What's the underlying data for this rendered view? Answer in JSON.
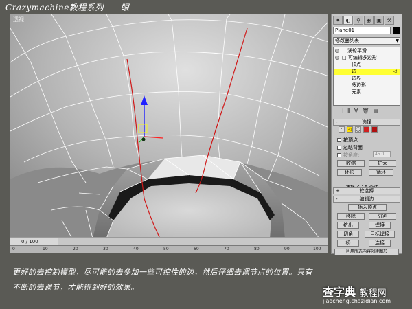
{
  "header": {
    "title": "Crazymachine教程系列——眼"
  },
  "viewport": {
    "label": "透视",
    "timeline": {
      "slider_text": "0 / 100"
    },
    "ruler_ticks": [
      "0",
      "10",
      "20",
      "30",
      "40",
      "50",
      "60",
      "70",
      "80",
      "90",
      "100"
    ]
  },
  "panel": {
    "tabs": [
      "create-tab",
      "modify-tab",
      "hierarchy-tab",
      "motion-tab",
      "display-tab",
      "utilities-tab"
    ],
    "object_name": "Plane01",
    "object_color": "#000000",
    "modifier_list": "修改器列表",
    "stack": [
      {
        "label": "涡轮平滑",
        "tag": ""
      },
      {
        "label": "□ 可编辑多边形",
        "tag": ""
      },
      {
        "label": "顶点",
        "tag": ""
      },
      {
        "label": "边",
        "tag": "◁",
        "selected": true
      },
      {
        "label": "边界",
        "tag": ""
      },
      {
        "label": "多边形",
        "tag": ""
      },
      {
        "label": "元素",
        "tag": ""
      }
    ],
    "stack_tools": [
      "pin-stack-icon",
      "show-end-result-icon",
      "make-unique-icon",
      "remove-modifier-icon",
      "configure-sets-icon"
    ],
    "selection_rollout": {
      "title": "选择",
      "subobject_icons": [
        "vertex-icon",
        "edge-icon",
        "border-icon",
        "polygon-icon",
        "element-icon"
      ],
      "by_vertex": "按顶点",
      "ignore_backfacing": "忽略背面",
      "by_angle": "按角度:",
      "angle_value": "45.0",
      "shrink": "收缩",
      "grow": "扩大",
      "ring": "环形",
      "loop": "循环",
      "selected_count": "选择了 16 个边"
    },
    "soft_selection": {
      "title": "软选择"
    },
    "edit_edges": {
      "title": "编辑边",
      "insert_vertex": "插入顶点",
      "remove": "移除",
      "split": "分割",
      "extrude": "挤出",
      "weld": "焊接",
      "chamfer": "切角",
      "target_weld": "目标焊接",
      "bridge": "桥",
      "connect": "连接",
      "create_shape": "利用所选内容创建图形"
    }
  },
  "caption": {
    "line1": "更好的去控制模型，尽可能的去多加一些可控性的边，然后仔细去调节点的位置。只有",
    "line2": "不断的去调节，才能得到好的效果。"
  },
  "watermark": {
    "brand": "查字典",
    "brand_sub": "教程网",
    "url": "jiaocheng.chazidian.com"
  }
}
